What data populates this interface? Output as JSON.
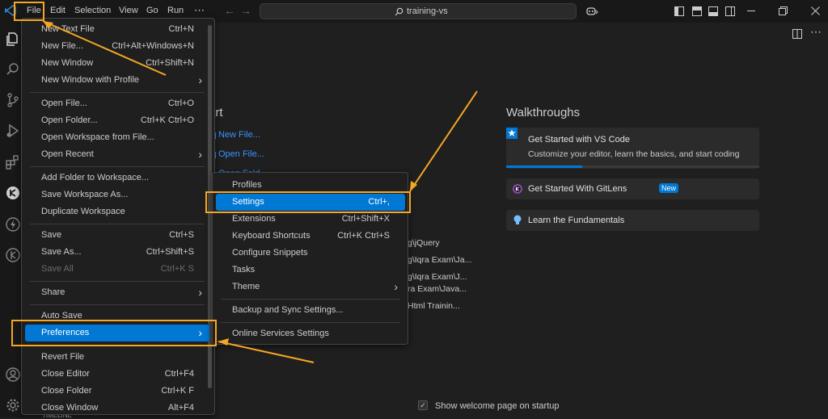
{
  "titlebar": {
    "menus": [
      "File",
      "Edit",
      "Selection",
      "View",
      "Go",
      "Run",
      "⋯"
    ],
    "search": "training-vs"
  },
  "file_menu": {
    "items": [
      {
        "label": "New Text File",
        "key": "Ctrl+N"
      },
      {
        "label": "New File...",
        "key": "Ctrl+Alt+Windows+N"
      },
      {
        "label": "New Window",
        "key": "Ctrl+Shift+N"
      },
      {
        "label": "New Window with Profile",
        "key": "›"
      },
      {
        "label": "Open File...",
        "key": "Ctrl+O"
      },
      {
        "label": "Open Folder...",
        "key": "Ctrl+K Ctrl+O"
      },
      {
        "label": "Open Workspace from File...",
        "key": ""
      },
      {
        "label": "Open Recent",
        "key": "›"
      },
      {
        "label": "Add Folder to Workspace...",
        "key": ""
      },
      {
        "label": "Save Workspace As...",
        "key": ""
      },
      {
        "label": "Duplicate Workspace",
        "key": ""
      },
      {
        "label": "Save",
        "key": "Ctrl+S"
      },
      {
        "label": "Save As...",
        "key": "Ctrl+Shift+S"
      },
      {
        "label": "Save All",
        "key": "Ctrl+K S"
      },
      {
        "label": "Share",
        "key": "›"
      },
      {
        "label": "Auto Save",
        "key": ""
      },
      {
        "label": "Preferences",
        "key": "›"
      },
      {
        "label": "Revert File",
        "key": ""
      },
      {
        "label": "Close Editor",
        "key": "Ctrl+F4"
      },
      {
        "label": "Close Folder",
        "key": "Ctrl+K F"
      },
      {
        "label": "Close Window",
        "key": "Alt+F4"
      }
    ]
  },
  "pref_menu": {
    "items": [
      {
        "label": "Profiles",
        "key": ""
      },
      {
        "label": "Settings",
        "key": "Ctrl+,"
      },
      {
        "label": "Extensions",
        "key": "Ctrl+Shift+X"
      },
      {
        "label": "Keyboard Shortcuts",
        "key": "Ctrl+K Ctrl+S"
      },
      {
        "label": "Configure Snippets",
        "key": ""
      },
      {
        "label": "Tasks",
        "key": ""
      },
      {
        "label": "Theme",
        "key": "›"
      },
      {
        "label": "Backup and Sync Settings...",
        "key": ""
      },
      {
        "label": "Online Services Settings",
        "key": ""
      }
    ]
  },
  "welcome": {
    "start_partial": "art",
    "start_links": [
      "New File...",
      "Open File...",
      "Open Fold"
    ],
    "recent_partials": [
      "g\\jQuery",
      "g\\Iqra Exam\\Ja...",
      "g\\Iqra Exam\\J...",
      "ra Exam\\Java...",
      "Html Trainin..."
    ],
    "walkthroughs_title": "Walkthroughs",
    "card1_title": "Get Started with VS Code",
    "card1_desc": "Customize your editor, learn the basics, and start coding",
    "card1_progress": 0.3,
    "card2_title": "Get Started With GitLens",
    "card2_badge": "New",
    "card3_title": "Learn the Fundamentals",
    "show_welcome": "Show welcome page on startup",
    "timeline": "TIMELINE"
  },
  "colors": {
    "highlight": "#f5a623",
    "accent": "#0078d4"
  }
}
